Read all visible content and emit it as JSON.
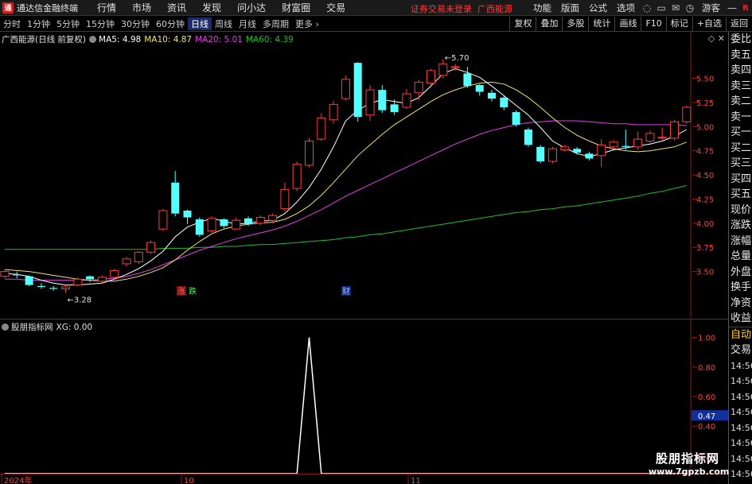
{
  "app": {
    "title": "通达信金融终端",
    "logo_glyph": "通"
  },
  "menu": [
    "行情",
    "市场",
    "资讯",
    "发现",
    "问小达",
    "财富圈",
    "交易"
  ],
  "status_text": "证券交易未登录",
  "stock_name_top": "广西能源",
  "top_right": {
    "items": [
      "功能",
      "版面",
      "公式",
      "选项"
    ],
    "user": "游客",
    "r_label": "R"
  },
  "periods": [
    "分时",
    "1分钟",
    "5分钟",
    "15分钟",
    "30分钟",
    "60分钟",
    "日线",
    "周线",
    "月线",
    "多周期",
    "更多"
  ],
  "active_period": "日线",
  "tools": [
    "复权",
    "叠加",
    "多股",
    "统计",
    "画线",
    "F10",
    "标记",
    "+自选",
    "返回"
  ],
  "main_legend": {
    "title": "广西能源(日线 前复权)",
    "ma5": "MA5: 4.98",
    "ma10": "MA10: 4.87",
    "ma20": "MA20: 5.01",
    "ma60": "MA60: 4.39"
  },
  "indicator_legend": {
    "title": "股朋指标网",
    "value": "XG: 0.00"
  },
  "right_panel": {
    "items": [
      "委比",
      "卖五",
      "卖四",
      "卖三",
      "卖二",
      "卖一",
      "买一",
      "买二",
      "买三",
      "买四",
      "买五",
      "现价",
      "涨跌",
      "涨幅",
      "总量",
      "外盘",
      "换手",
      "净资",
      "收益"
    ],
    "lower": [
      "自动",
      "交易"
    ],
    "times": [
      "14:56",
      "14:56",
      "14:56",
      "14:56",
      "14:56",
      "14:56",
      "14:56",
      "14:56",
      "14:56"
    ]
  },
  "annotations": {
    "high": "5.70",
    "low": "3.28",
    "marker_zhang": "涨",
    "marker_die": "跌",
    "marker_cai": "财"
  },
  "x_axis": [
    "2024年",
    "10",
    "11"
  ],
  "watermark": {
    "line1": "股朋指标网",
    "line2": "www.7gpzb.com"
  },
  "colors": {
    "up": "#ff3c3c",
    "down": "#54ffff",
    "ma5": "#ffffff",
    "ma10": "#f0e27a",
    "ma20": "#e040e0",
    "ma60": "#20c020",
    "indicator": "#ffffff",
    "axis_highlight": "#1030a0"
  },
  "chart_data": [
    {
      "type": "candlestick",
      "title": "广西能源(日线 前复权)",
      "ylim": [
        3.25,
        5.85
      ],
      "y_ticks": [
        3.5,
        3.75,
        4.0,
        4.25,
        4.5,
        4.75,
        5.0,
        5.25,
        5.5
      ],
      "candles": [
        {
          "o": 3.45,
          "c": 3.5,
          "h": 3.52,
          "l": 3.43
        },
        {
          "o": 3.47,
          "c": 3.46,
          "h": 3.5,
          "l": 3.43
        },
        {
          "o": 3.45,
          "c": 3.36,
          "h": 3.46,
          "l": 3.35
        },
        {
          "o": 3.35,
          "c": 3.34,
          "h": 3.38,
          "l": 3.32
        },
        {
          "o": 3.33,
          "c": 3.32,
          "h": 3.35,
          "l": 3.3
        },
        {
          "o": 3.32,
          "c": 3.34,
          "h": 3.36,
          "l": 3.28
        },
        {
          "o": 3.36,
          "c": 3.42,
          "h": 3.44,
          "l": 3.35
        },
        {
          "o": 3.45,
          "c": 3.42,
          "h": 3.46,
          "l": 3.39
        },
        {
          "o": 3.4,
          "c": 3.44,
          "h": 3.46,
          "l": 3.38
        },
        {
          "o": 3.44,
          "c": 3.51,
          "h": 3.53,
          "l": 3.42
        },
        {
          "o": 3.58,
          "c": 3.63,
          "h": 3.65,
          "l": 3.55
        },
        {
          "o": 3.6,
          "c": 3.7,
          "h": 3.71,
          "l": 3.58
        },
        {
          "o": 3.7,
          "c": 3.8,
          "h": 3.82,
          "l": 3.68
        },
        {
          "o": 3.94,
          "c": 4.13,
          "h": 4.15,
          "l": 3.92
        },
        {
          "o": 4.42,
          "c": 4.1,
          "h": 4.54,
          "l": 4.07
        },
        {
          "o": 4.13,
          "c": 4.06,
          "h": 4.14,
          "l": 3.99
        },
        {
          "o": 4.04,
          "c": 3.88,
          "h": 4.06,
          "l": 3.86
        },
        {
          "o": 3.92,
          "c": 4.05,
          "h": 4.07,
          "l": 3.9
        },
        {
          "o": 4.04,
          "c": 3.97,
          "h": 4.05,
          "l": 3.95
        },
        {
          "o": 3.94,
          "c": 4.03,
          "h": 4.06,
          "l": 3.93
        },
        {
          "o": 4.05,
          "c": 3.99,
          "h": 4.07,
          "l": 3.97
        },
        {
          "o": 4.0,
          "c": 4.06,
          "h": 4.08,
          "l": 3.98
        },
        {
          "o": 4.03,
          "c": 4.08,
          "h": 4.1,
          "l": 4.0
        },
        {
          "o": 4.15,
          "c": 4.35,
          "h": 4.42,
          "l": 4.12
        },
        {
          "o": 4.36,
          "c": 4.61,
          "h": 4.64,
          "l": 4.33
        },
        {
          "o": 4.6,
          "c": 4.85,
          "h": 4.88,
          "l": 4.58
        },
        {
          "o": 4.87,
          "c": 5.09,
          "h": 5.14,
          "l": 4.85
        },
        {
          "o": 5.07,
          "c": 5.23,
          "h": 5.27,
          "l": 5.03
        },
        {
          "o": 5.29,
          "c": 5.49,
          "h": 5.53,
          "l": 5.27
        },
        {
          "o": 5.66,
          "c": 5.1,
          "h": 5.67,
          "l": 5.05
        },
        {
          "o": 5.12,
          "c": 5.38,
          "h": 5.43,
          "l": 5.06
        },
        {
          "o": 5.38,
          "c": 5.17,
          "h": 5.43,
          "l": 5.14
        },
        {
          "o": 5.23,
          "c": 5.15,
          "h": 5.28,
          "l": 5.12
        },
        {
          "o": 5.2,
          "c": 5.34,
          "h": 5.39,
          "l": 5.18
        },
        {
          "o": 5.35,
          "c": 5.46,
          "h": 5.48,
          "l": 5.27
        },
        {
          "o": 5.45,
          "c": 5.58,
          "h": 5.6,
          "l": 5.43
        },
        {
          "o": 5.53,
          "c": 5.65,
          "h": 5.7,
          "l": 5.5
        },
        {
          "o": 5.62,
          "c": 5.62,
          "h": 5.65,
          "l": 5.58
        },
        {
          "o": 5.55,
          "c": 5.42,
          "h": 5.62,
          "l": 5.4
        },
        {
          "o": 5.43,
          "c": 5.36,
          "h": 5.44,
          "l": 5.32
        },
        {
          "o": 5.35,
          "c": 5.29,
          "h": 5.38,
          "l": 5.26
        },
        {
          "o": 5.3,
          "c": 5.2,
          "h": 5.32,
          "l": 5.17
        },
        {
          "o": 5.15,
          "c": 5.02,
          "h": 5.17,
          "l": 5.0
        },
        {
          "o": 4.97,
          "c": 4.81,
          "h": 4.99,
          "l": 4.79
        },
        {
          "o": 4.79,
          "c": 4.64,
          "h": 4.81,
          "l": 4.62
        },
        {
          "o": 4.64,
          "c": 4.77,
          "h": 4.79,
          "l": 4.62
        },
        {
          "o": 4.76,
          "c": 4.79,
          "h": 4.81,
          "l": 4.74
        },
        {
          "o": 4.77,
          "c": 4.73,
          "h": 4.79,
          "l": 4.71
        },
        {
          "o": 4.72,
          "c": 4.67,
          "h": 4.74,
          "l": 4.65
        },
        {
          "o": 4.7,
          "c": 4.81,
          "h": 4.87,
          "l": 4.58
        },
        {
          "o": 4.79,
          "c": 4.84,
          "h": 4.86,
          "l": 4.77
        },
        {
          "o": 4.8,
          "c": 4.79,
          "h": 4.97,
          "l": 4.76
        },
        {
          "o": 4.79,
          "c": 4.87,
          "h": 4.95,
          "l": 4.76
        },
        {
          "o": 4.85,
          "c": 4.93,
          "h": 4.96,
          "l": 4.83
        },
        {
          "o": 4.89,
          "c": 4.89,
          "h": 4.99,
          "l": 4.86
        },
        {
          "o": 4.88,
          "c": 5.05,
          "h": 5.07,
          "l": 4.86
        },
        {
          "o": 5.05,
          "c": 5.2,
          "h": 5.22,
          "l": 5.03
        }
      ],
      "ma5": [
        3.48,
        3.47,
        3.45,
        3.41,
        3.38,
        3.36,
        3.36,
        3.37,
        3.38,
        3.42,
        3.47,
        3.53,
        3.61,
        3.71,
        3.86,
        3.96,
        4.01,
        4.05,
        4.02,
        3.99,
        4.0,
        4.02,
        4.03,
        4.1,
        4.22,
        4.37,
        4.56,
        4.79,
        5.06,
        5.17,
        5.24,
        5.28,
        5.26,
        5.24,
        5.3,
        5.42,
        5.55,
        5.6,
        5.56,
        5.51,
        5.42,
        5.32,
        5.22,
        5.12,
        4.99,
        4.85,
        4.78,
        4.72,
        4.69,
        4.72,
        4.76,
        4.78,
        4.8,
        4.82,
        4.85,
        4.9,
        4.97
      ],
      "ma10": [
        3.52,
        3.51,
        3.5,
        3.48,
        3.46,
        3.44,
        3.42,
        3.41,
        3.4,
        3.4,
        3.42,
        3.45,
        3.49,
        3.54,
        3.62,
        3.72,
        3.81,
        3.89,
        3.94,
        3.97,
        3.99,
        4.0,
        4.01,
        4.04,
        4.1,
        4.18,
        4.29,
        4.42,
        4.56,
        4.7,
        4.81,
        4.92,
        5.02,
        5.1,
        5.18,
        5.26,
        5.33,
        5.38,
        5.42,
        5.45,
        5.46,
        5.44,
        5.38,
        5.3,
        5.2,
        5.09,
        4.99,
        4.91,
        4.85,
        4.8,
        4.77,
        4.75,
        4.74,
        4.75,
        4.77,
        4.79,
        4.84
      ],
      "ma20": [
        3.42,
        3.42,
        3.41,
        3.41,
        3.41,
        3.41,
        3.41,
        3.41,
        3.42,
        3.43,
        3.45,
        3.48,
        3.52,
        3.57,
        3.62,
        3.67,
        3.72,
        3.76,
        3.8,
        3.84,
        3.87,
        3.9,
        3.93,
        3.97,
        4.02,
        4.08,
        4.14,
        4.21,
        4.28,
        4.34,
        4.4,
        4.46,
        4.52,
        4.58,
        4.64,
        4.7,
        4.76,
        4.82,
        4.87,
        4.92,
        4.96,
        4.99,
        5.02,
        5.04,
        5.05,
        5.06,
        5.06,
        5.06,
        5.05,
        5.04,
        5.03,
        5.03,
        5.02,
        5.02,
        5.02,
        5.02,
        5.01
      ],
      "ma60": [
        3.73,
        3.73,
        3.73,
        3.73,
        3.73,
        3.73,
        3.73,
        3.73,
        3.73,
        3.73,
        3.73,
        3.73,
        3.73,
        3.74,
        3.74,
        3.74,
        3.75,
        3.75,
        3.76,
        3.76,
        3.77,
        3.78,
        3.78,
        3.79,
        3.8,
        3.81,
        3.82,
        3.83,
        3.85,
        3.86,
        3.88,
        3.89,
        3.91,
        3.93,
        3.95,
        3.97,
        3.99,
        4.01,
        4.03,
        4.05,
        4.07,
        4.09,
        4.11,
        4.12,
        4.14,
        4.15,
        4.17,
        4.18,
        4.2,
        4.22,
        4.24,
        4.26,
        4.28,
        4.31,
        4.33,
        4.36,
        4.39
      ]
    },
    {
      "type": "line",
      "title": "股朋指标网",
      "ylim": [
        0.1,
        1.1
      ],
      "y_ticks": [
        0.2,
        0.4,
        0.6,
        0.8,
        1.0
      ],
      "current_value_label": "0.47",
      "values": [
        0,
        0,
        0,
        0,
        0,
        0,
        0,
        0,
        0,
        0,
        0,
        0,
        0,
        0,
        0,
        0,
        0,
        0,
        0,
        0,
        0,
        0,
        0,
        0,
        0,
        0,
        0,
        0,
        0,
        0,
        0,
        0,
        0,
        0,
        0,
        0,
        0,
        0,
        0,
        0,
        0,
        0,
        0,
        0,
        0,
        0,
        0,
        0,
        0,
        0,
        0,
        0,
        0,
        0,
        0,
        0,
        0
      ],
      "spike_index": 25,
      "spike_value": 1.0
    }
  ]
}
